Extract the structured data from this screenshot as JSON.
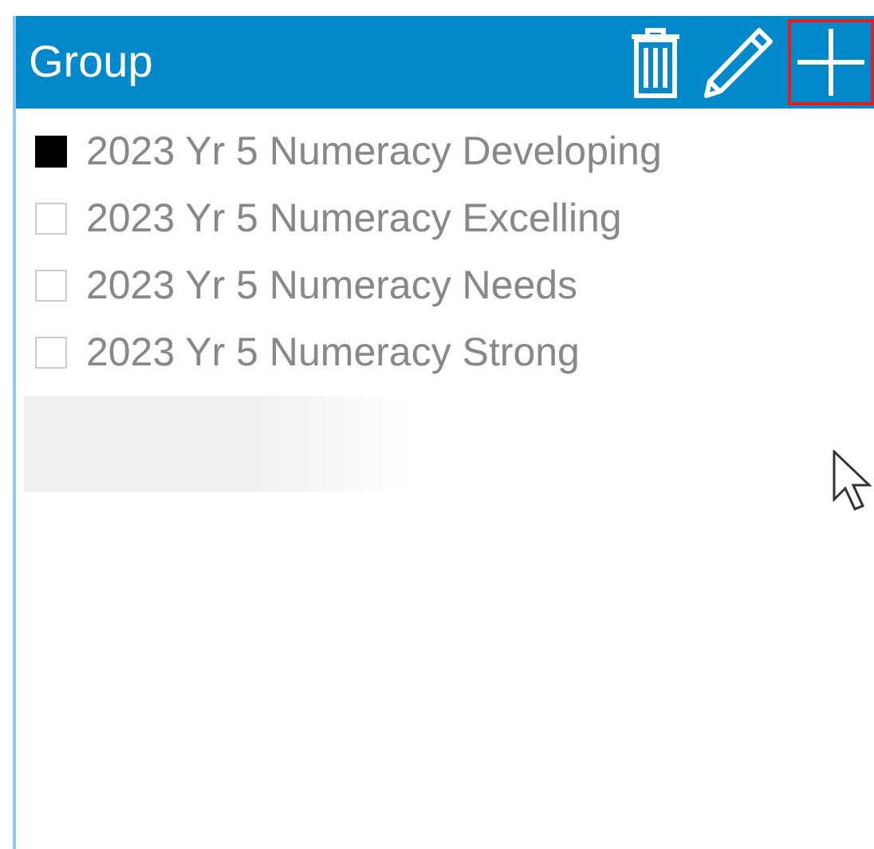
{
  "header": {
    "title": "Group",
    "add_highlighted": true
  },
  "items": [
    {
      "label": "2023 Yr 5 Numeracy Developing",
      "checked": true
    },
    {
      "label": "2023 Yr 5 Numeracy Excelling",
      "checked": false
    },
    {
      "label": "2023 Yr 5 Numeracy Needs",
      "checked": false
    },
    {
      "label": "2023 Yr 5 Numeracy Strong",
      "checked": false
    }
  ]
}
